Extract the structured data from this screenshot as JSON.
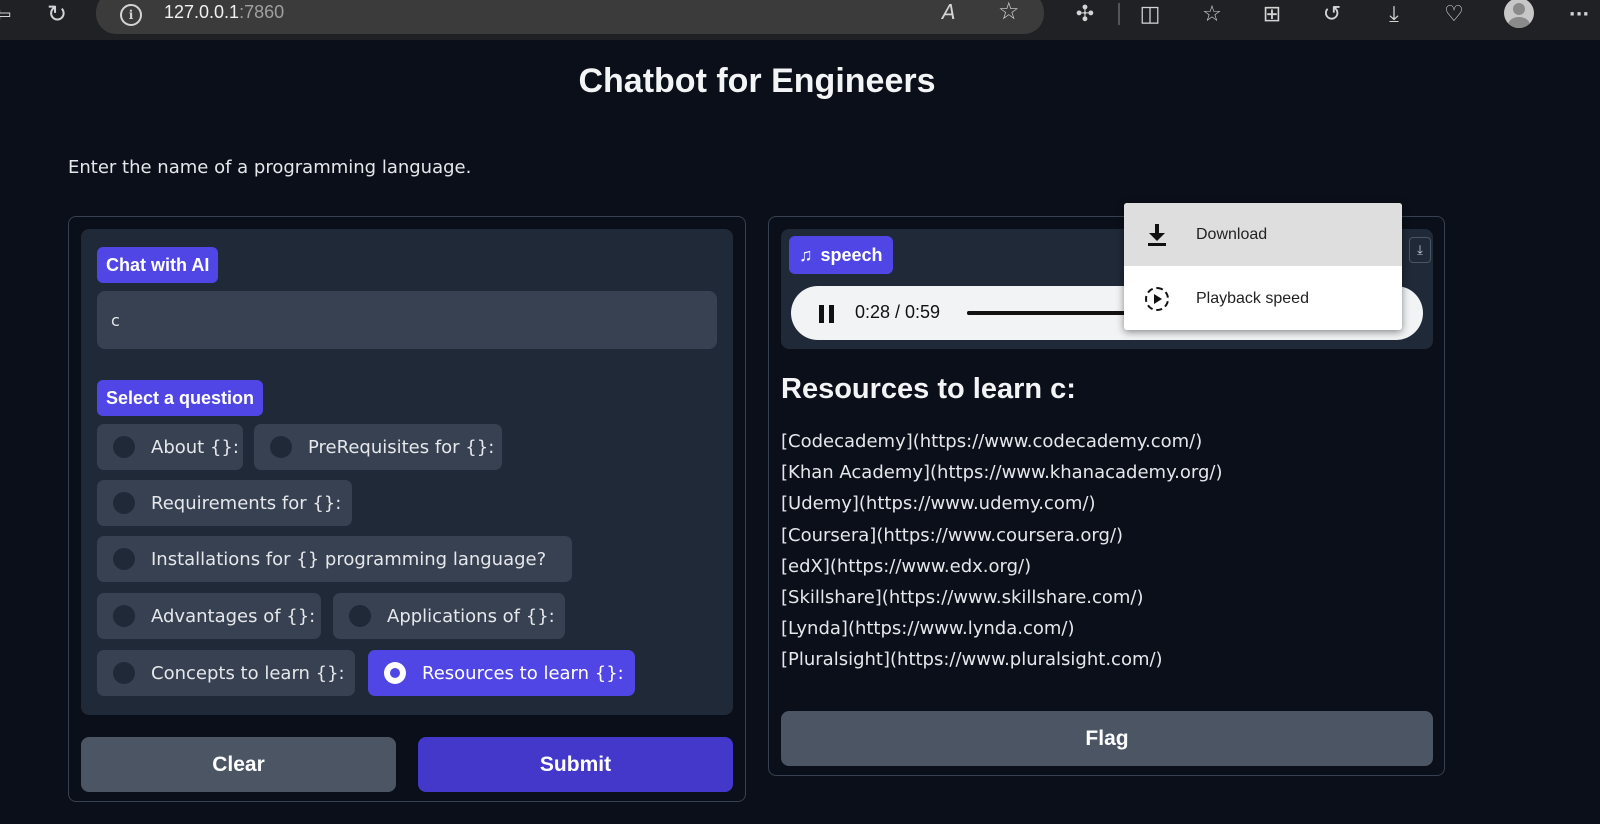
{
  "browser": {
    "url_host": "127.0.0.1",
    "url_port": ":7860",
    "icons": [
      "back-icon",
      "refresh-icon",
      "site-info-icon",
      "read-aloud-icon",
      "favorite-star-icon",
      "extensions-icon",
      "split-screen-icon",
      "favorites-icon",
      "collections-icon",
      "history-icon",
      "downloads-icon",
      "browser-essentials-icon",
      "profile-avatar",
      "more-icon"
    ],
    "icon_glyphs": {
      "back": "⇦",
      "refresh": "↻",
      "info": "i",
      "read_aloud": "A",
      "star": "☆",
      "extensions": "✣",
      "split": "◫",
      "favorites": "☆",
      "collections": "⊞",
      "history": "↺",
      "downloads": "⤓",
      "essentials": "♡",
      "more": "···"
    }
  },
  "page": {
    "title": "Chatbot for Engineers",
    "description": "Enter the name of a programming language."
  },
  "chat": {
    "label": "Chat with AI",
    "input_value": "c"
  },
  "question": {
    "label": "Select a question",
    "options": [
      {
        "label": "About {}:",
        "selected": false
      },
      {
        "label": "PreRequisites for {}:",
        "selected": false
      },
      {
        "label": "Requirements for {}:",
        "selected": false
      },
      {
        "label": "Installations for {} programming language?",
        "selected": false
      },
      {
        "label": "Advantages of {}:",
        "selected": false
      },
      {
        "label": "Applications of {}:",
        "selected": false
      },
      {
        "label": "Concepts to learn {}:",
        "selected": false
      },
      {
        "label": "Resources to learn {}:",
        "selected": true
      }
    ]
  },
  "buttons": {
    "clear": "Clear",
    "submit": "Submit",
    "flag": "Flag"
  },
  "audio": {
    "label": "speech",
    "music_icon": "♫",
    "download_icon": "⤓",
    "time": "0:28 / 0:59",
    "progress": 0.475
  },
  "output": {
    "title": "Resources to learn c:",
    "links": [
      "[Codecademy](https://www.codecademy.com/)",
      "[Khan Academy](https://www.khanacademy.org/)",
      "[Udemy](https://www.udemy.com/)",
      "[Coursera](https://www.coursera.org/)",
      "[edX](https://www.edx.org/)",
      "[Skillshare](https://www.skillshare.com/)",
      "[Lynda](https://www.lynda.com/)",
      "[Pluralsight](https://www.pluralsight.com/)"
    ]
  },
  "menu": {
    "items": [
      {
        "label": "Download",
        "icon": "download-icon",
        "highlighted": true
      },
      {
        "label": "Playback speed",
        "icon": "playback-speed-icon",
        "highlighted": false
      }
    ]
  },
  "colors": {
    "background": "#0b0f19",
    "accent": "#4f46e5",
    "submit": "#4338ca",
    "block": "#1f2937",
    "input": "#374151"
  }
}
